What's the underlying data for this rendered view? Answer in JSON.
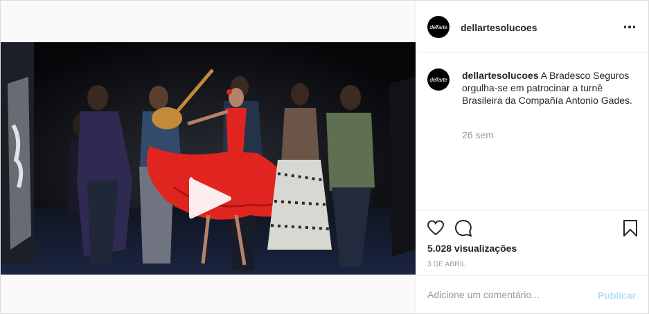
{
  "post": {
    "username": "dellartesolucoes",
    "avatar_text": "dell'arte",
    "caption": "A Bradesco Seguros orgulha-se em patrocinar a turnê Brasileira da Compañía Antonio Gades.",
    "time_ago": "26 sem",
    "views": "5.028 visualizações",
    "date": "3 DE ABRIL"
  },
  "comment_bar": {
    "placeholder": "Adicione um comentário...",
    "publish_label": "Publicar"
  },
  "icons": {
    "more": "more-options-icon",
    "play": "play-icon",
    "like": "heart-icon",
    "comment": "comment-icon",
    "save": "bookmark-icon"
  },
  "colors": {
    "dress": "#e0241f",
    "publish_disabled": "#b2dffc",
    "meta_text": "#999999"
  }
}
